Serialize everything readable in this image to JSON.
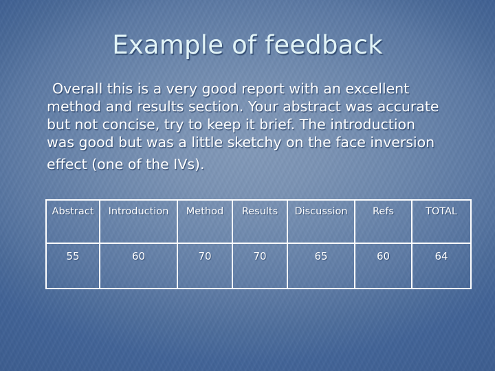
{
  "slide": {
    "title": "Example of feedback",
    "background_color": "#5d7aa4",
    "title_color": "#e2f4f7",
    "text_color": "#ffffff"
  },
  "body": {
    "lines": [
      "Overall this is a very good report with an excellent",
      "method and results section. Your abstract was accurate",
      "but not concise, try to keep it brief. The introduction",
      "was good but was a little sketchy on the face inversion",
      "effect (one of the IVs)."
    ]
  },
  "table": {
    "headers": [
      "Abstract",
      "Introduction",
      "Method",
      "Results",
      "Discussion",
      "Refs",
      "TOTAL"
    ],
    "rows": [
      [
        "55",
        "60",
        "70",
        "70",
        "65",
        "60",
        "64"
      ]
    ],
    "border_color": "#ffffff"
  }
}
